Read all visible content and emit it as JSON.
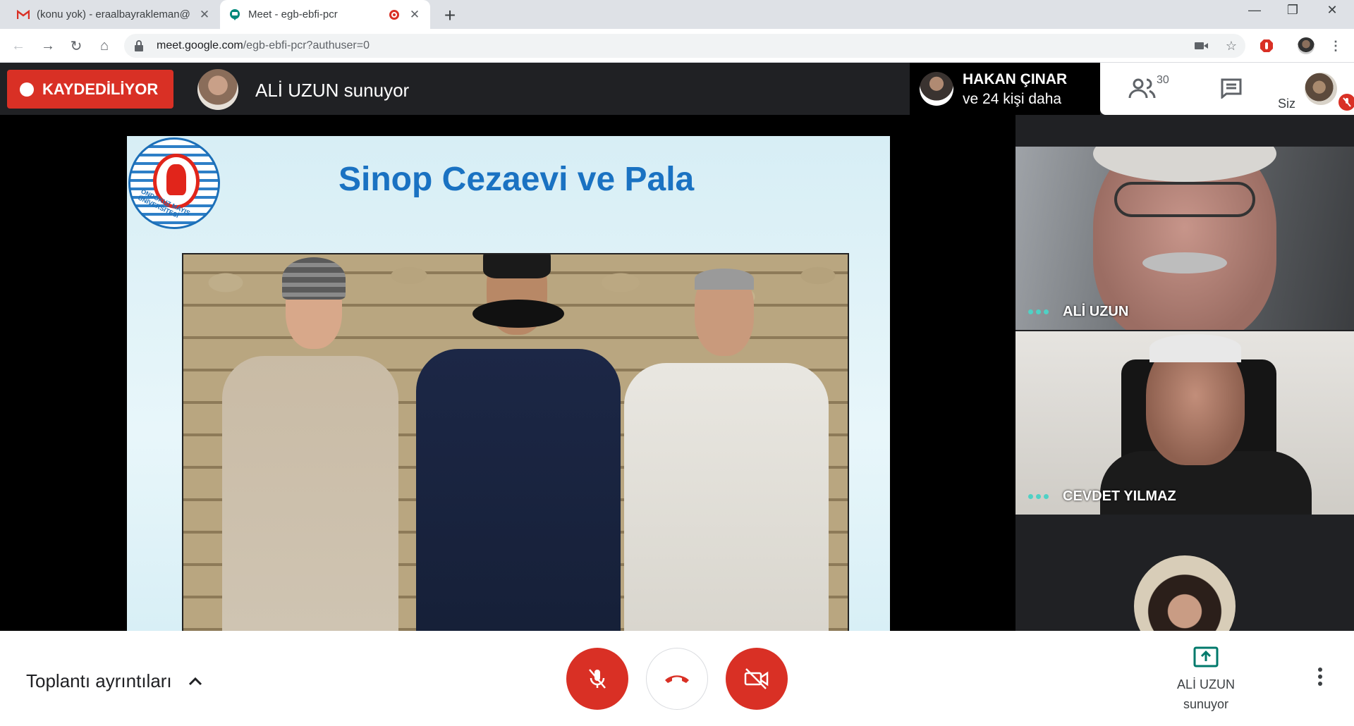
{
  "browser": {
    "tabs": [
      {
        "title": "(konu yok) - eraalbayrakleman@",
        "icon": "gmail-icon",
        "active": false
      },
      {
        "title": "Meet - egb-ebfi-pcr",
        "icon": "meet-icon",
        "active": true,
        "recording": true
      }
    ],
    "url_host": "meet.google.com",
    "url_path": "/egb-ebfi-pcr?authuser=0"
  },
  "meet": {
    "recording_label": "KAYDEDİLİYOR",
    "presenter_text": "ALİ UZUN sunuyor",
    "participants_preview_name": "HAKAN ÇINAR",
    "participants_preview_more": "ve 24 kişi daha",
    "participant_count": "30",
    "self_label": "Siz",
    "slide": {
      "title": "Sinop Cezaevi ve Pala",
      "logo_text": "ONDOKUZ MAYIS ÜNİVERSİTESİ"
    },
    "tiles": [
      {
        "name": "ALİ UZUN"
      },
      {
        "name": "CEVDET YILMAZ"
      }
    ],
    "bottom": {
      "details_label": "Toplantı ayrıntıları",
      "presenting_name": "ALİ UZUN",
      "presenting_suffix": "sunuyor"
    }
  },
  "colors": {
    "accent_red": "#d93025",
    "slide_title_blue": "#1a72c2",
    "meet_dark": "#202124",
    "speaking_dots": "#4fd1c5"
  }
}
